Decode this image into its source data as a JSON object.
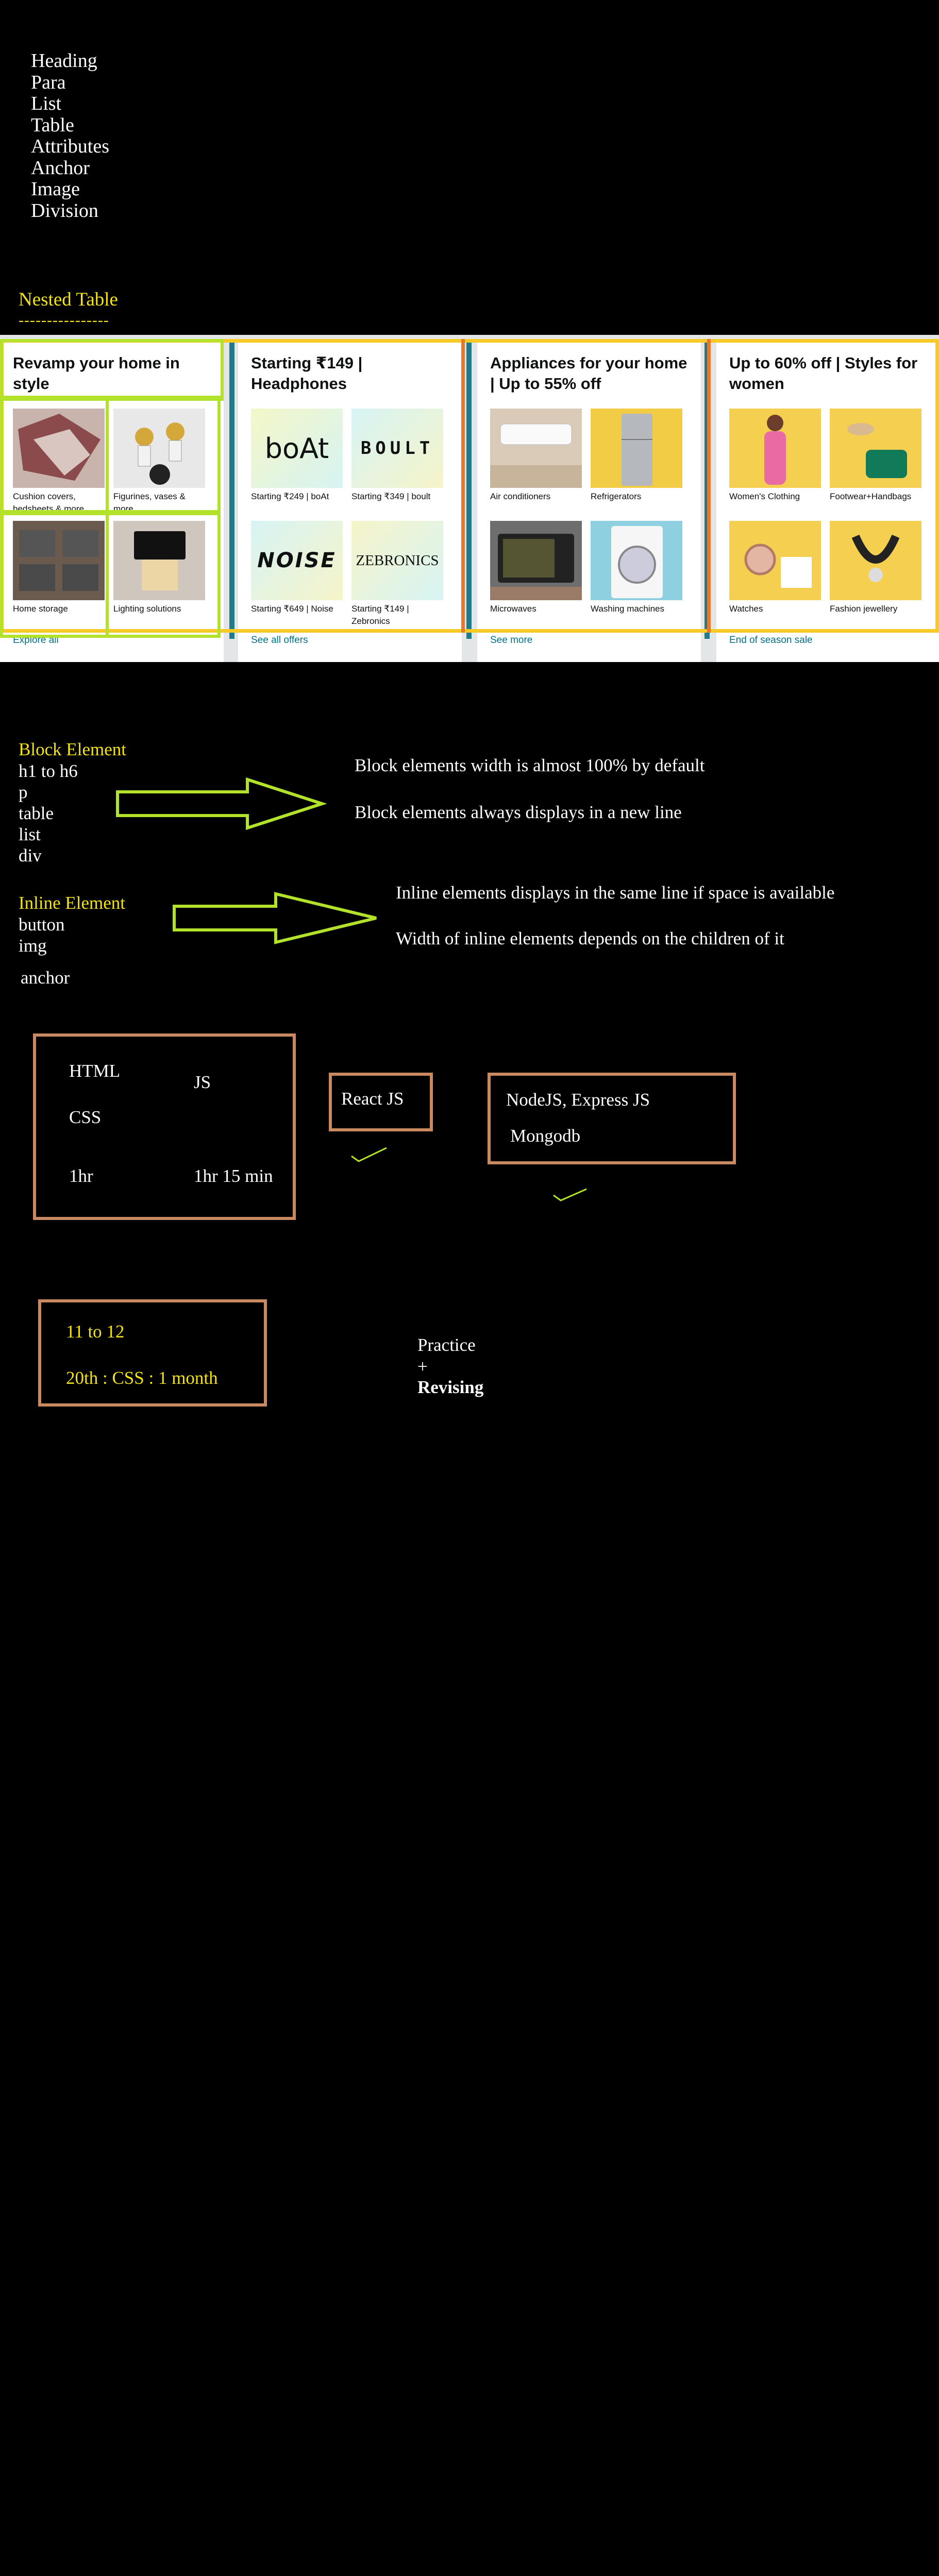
{
  "topics": [
    "Heading",
    "Para",
    "List",
    "Table",
    "Attributes",
    "Anchor",
    "Image",
    "Division"
  ],
  "nested_table": {
    "title": "Nested Table",
    "underline": "----------------"
  },
  "amazon_cards": [
    {
      "title": "Revamp your home in style",
      "tiles": [
        {
          "caption": "Cushion covers, bedsheets & more",
          "icon": "cushion-image"
        },
        {
          "caption": "Figurines, vases & more",
          "icon": "figurine-image"
        },
        {
          "caption": "Home storage",
          "icon": "storage-image"
        },
        {
          "caption": "Lighting solutions",
          "icon": "lighting-image"
        }
      ],
      "link": "Explore all"
    },
    {
      "title": "Starting ₹149 | Headphones",
      "tiles": [
        {
          "caption": "Starting ₹249 | boAt",
          "logo": "boAt"
        },
        {
          "caption": "Starting ₹349 | boult",
          "logo": "BOULT"
        },
        {
          "caption": "Starting ₹649 | Noise",
          "logo": "NOISE"
        },
        {
          "caption": "Starting ₹149 | Zebronics",
          "logo": "ZEBRONICS"
        }
      ],
      "link": "See all offers"
    },
    {
      "title": "Appliances for your home | Up to 55% off",
      "tiles": [
        {
          "caption": "Air conditioners",
          "icon": "ac-image"
        },
        {
          "caption": "Refrigerators",
          "icon": "fridge-image"
        },
        {
          "caption": "Microwaves",
          "icon": "microwave-image"
        },
        {
          "caption": "Washing machines",
          "icon": "washer-image"
        }
      ],
      "link": "See more"
    },
    {
      "title": "Up to 60% off | Styles for women",
      "tiles": [
        {
          "caption": "Women's Clothing",
          "icon": "clothing-image"
        },
        {
          "caption": "Footwear+Handbags",
          "icon": "footwear-image"
        },
        {
          "caption": "Watches",
          "icon": "watch-image"
        },
        {
          "caption": "Fashion jewellery",
          "icon": "jewellery-image"
        }
      ],
      "link": "End of season sale"
    }
  ],
  "block": {
    "title": "Block Element",
    "items": [
      "h1 to h6",
      "p",
      "table",
      "list",
      "div"
    ],
    "notes": [
      "Block elements width is  almost 100% by default",
      "Block elements always displays in a new line"
    ]
  },
  "inline": {
    "title": "Inline Element",
    "items": [
      "button",
      "img",
      "anchor"
    ],
    "notes": [
      "Inline elements displays in the same line if space is available",
      "Width of inline elements depends on the children of it"
    ]
  },
  "plan": {
    "box1": {
      "html": "HTML",
      "js": "JS",
      "css": "CSS",
      "t1": "1hr",
      "t2": "1hr 15 min"
    },
    "box2": "React JS",
    "box3": [
      "NodeJS, Express JS",
      "Mongodb"
    ]
  },
  "schedule": {
    "time": "11 to 12",
    "deadline": "20th : CSS : 1 month",
    "practice": "Practice",
    "plus": "+",
    "revising": "Revising"
  },
  "colors": {
    "background": "#000000",
    "yellow_text": "#f2e31a",
    "green_outline": "#b2e22a",
    "yellow_outline": "#f6c925",
    "box_border": "#c98a62",
    "link": "#007185"
  }
}
